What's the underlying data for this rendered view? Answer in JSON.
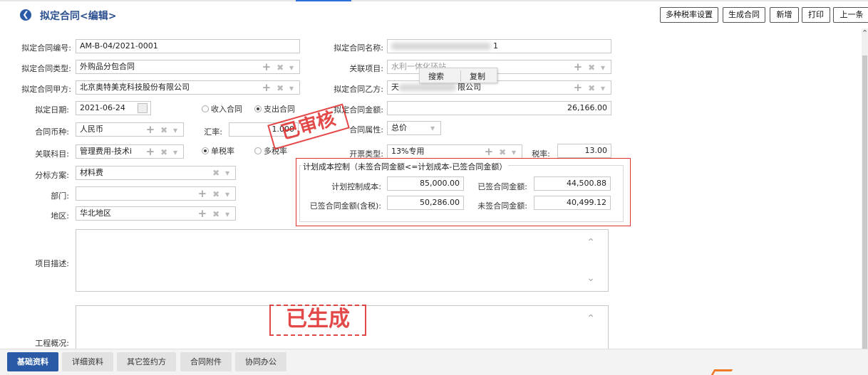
{
  "header": {
    "title": "拟定合同<编辑>",
    "toolbar": [
      "多种税率设置",
      "生成合同",
      "新增",
      "打印",
      "上一条"
    ]
  },
  "form": {
    "contract_no_label": "拟定合同编号:",
    "contract_no": "AM-B-04/2021-0001",
    "contract_name_label": "拟定合同名称:",
    "contract_name_visible": "1",
    "contract_type_label": "拟定合同类型:",
    "contract_type": "外购品分包合同",
    "related_project_label": "关联项目:",
    "related_project": "水利一体化环站",
    "party_a_label": "拟定合同甲方:",
    "party_a": "北京奥特美克科技股份有限公司",
    "party_b_label": "拟定合同乙方:",
    "party_b_visible_prefix": "天",
    "party_b_visible_suffix": "限公司",
    "date_label": "拟定日期:",
    "date": "2021-06-24",
    "radio_income": "收入合同",
    "radio_expense": "支出合同",
    "amount_label": "拟定合同金额:",
    "amount": "26,166.00",
    "currency_label": "合同币种:",
    "currency": "人民币",
    "rate_label": "汇率:",
    "rate": "1.000",
    "attr_label": "合同属性:",
    "attr": "总价",
    "subject_label": "关联科目:",
    "subject": "管理费用-技术i",
    "radio_single_tax": "单税率",
    "radio_multi_tax": "多税率",
    "invoice_type_label": "开票类型:",
    "invoice_type": "13%专用",
    "tax_rate_label": "税率:",
    "tax_rate": "13.00",
    "bid_label": "分标方案:",
    "bid": "材料费",
    "dept_label": "部门:",
    "dept": "",
    "region_label": "地区:",
    "region": "华北地区",
    "desc_label": "项目描述:",
    "overview_label": "工程概况:"
  },
  "plan": {
    "title": "计划成本控制（未签合同金额<=计划成本-已签合同金额）",
    "planned_cost_label": "计划控制成本:",
    "planned_cost": "85,000.00",
    "signed_label": "已签合同金额:",
    "signed": "44,500.88",
    "signed_tax_label": "已签合同金额(含税):",
    "signed_tax": "50,286.00",
    "unsigned_label": "未签合同金额:",
    "unsigned": "40,499.12"
  },
  "context_menu": {
    "search": "搜索",
    "copy": "复制"
  },
  "stamps": {
    "audited": "已审核",
    "generated": "已生成"
  },
  "tabs": [
    "基础资料",
    "详细资料",
    "其它签约方",
    "合同附件",
    "协同办公"
  ],
  "active_tab": 0,
  "colors": {
    "accent": "#2a5aa6",
    "stamp": "#e02a2a",
    "plan_border": "#e03030"
  }
}
